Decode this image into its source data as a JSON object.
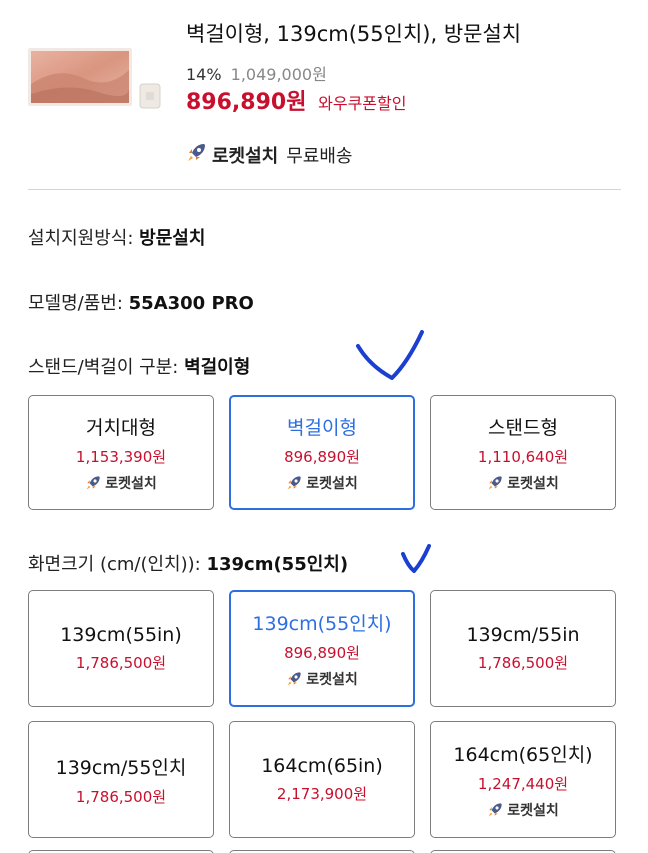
{
  "product": {
    "title": "벽걸이형, 139cm(55인치), 방문설치",
    "discount": "14%",
    "original_price": "1,049,000원",
    "price": "896,890원",
    "coupon": "와우쿠폰할인",
    "rocket_label": "로켓설치",
    "shipping": "무료배송"
  },
  "specs": {
    "install_label": "설치지원방식: ",
    "install_value": "방문설치",
    "model_label": "모델명/품번: ",
    "model_value": "55A300 PRO",
    "stand_label": "스탠드/벽걸이 구분: ",
    "stand_value": "벽걸이형",
    "screen_label": "화면크기 (cm/(인치)): ",
    "screen_value": "139cm(55인치)"
  },
  "stand_options": [
    {
      "name": "거치대형",
      "price": "1,153,390원",
      "rocket": "로켓설치",
      "selected": false
    },
    {
      "name": "벽걸이형",
      "price": "896,890원",
      "rocket": "로켓설치",
      "selected": true
    },
    {
      "name": "스탠드형",
      "price": "1,110,640원",
      "rocket": "로켓설치",
      "selected": false
    }
  ],
  "size_options": [
    {
      "name": "139cm(55in)",
      "price": "1,786,500원",
      "selected": false
    },
    {
      "name": "139cm(55인치)",
      "price": "896,890원",
      "rocket": "로켓설치",
      "selected": true
    },
    {
      "name": "139cm/55in",
      "price": "1,786,500원",
      "selected": false
    },
    {
      "name": "139cm/55인치",
      "price": "1,786,500원",
      "selected": false
    },
    {
      "name": "164cm(65in)",
      "price": "2,173,900원",
      "selected": false
    },
    {
      "name": "164cm(65인치)",
      "price": "1,247,440원",
      "rocket": "로켓설치",
      "selected": false
    }
  ],
  "colors": {
    "price_red": "#c8102e",
    "selected_blue": "#2e6fe0",
    "border_gray": "#7d7d7d"
  }
}
